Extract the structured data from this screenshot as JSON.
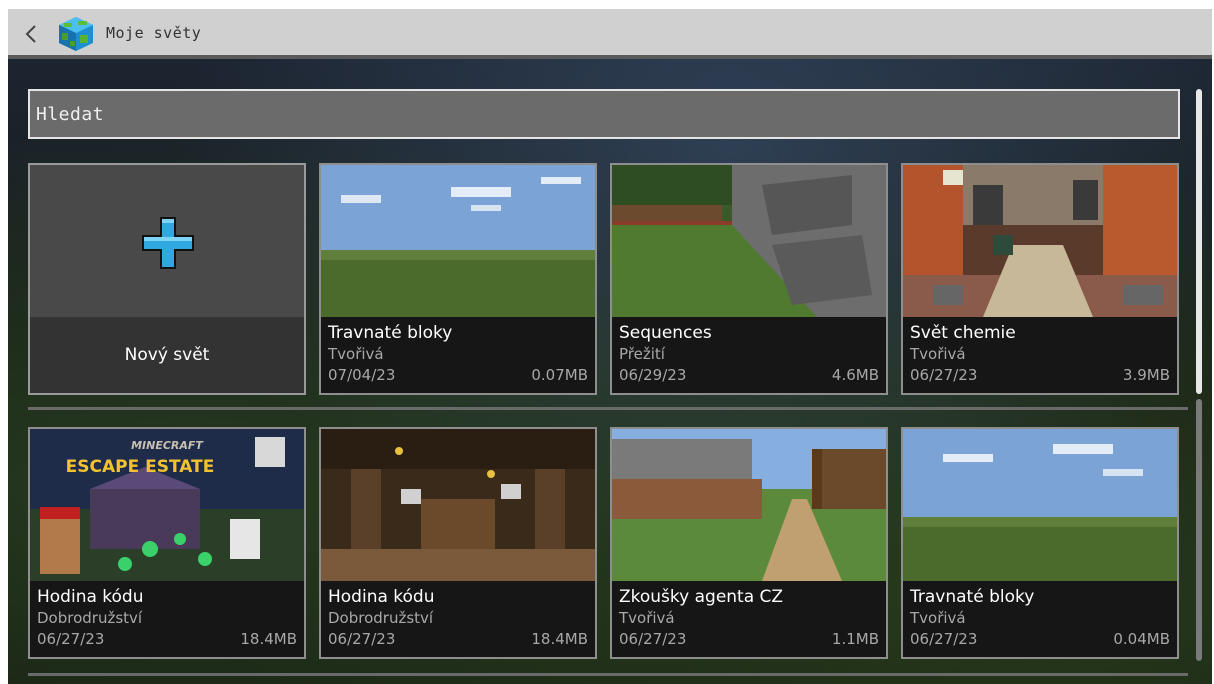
{
  "header": {
    "title": "Moje světy"
  },
  "search": {
    "label": "Hledat"
  },
  "new_world": {
    "label": "Nový svět"
  },
  "worlds": [
    {
      "name": "Travnaté bloky",
      "mode": "Tvořivá",
      "date": "07/04/23",
      "size": "0.07MB"
    },
    {
      "name": "Sequences",
      "mode": "Přežití",
      "date": "06/29/23",
      "size": "4.6MB"
    },
    {
      "name": "Svět chemie",
      "mode": "Tvořivá",
      "date": "06/27/23",
      "size": "3.9MB"
    },
    {
      "name": "Hodina kódu",
      "mode": "Dobrodružství",
      "date": "06/27/23",
      "size": "18.4MB"
    },
    {
      "name": "Hodina kódu",
      "mode": "Dobrodružství",
      "date": "06/27/23",
      "size": "18.4MB"
    },
    {
      "name": "Zkoušky agenta CZ",
      "mode": "Tvořivá",
      "date": "06/27/23",
      "size": "1.1MB"
    },
    {
      "name": "Travnaté bloky",
      "mode": "Tvořivá",
      "date": "06/27/23",
      "size": "0.04MB"
    }
  ],
  "thumbs": {
    "escape_line1": "MINECRAFT",
    "escape_line2": "ESCAPE ESTATE"
  },
  "colors": {
    "accent_plus": "#2fa8e0",
    "header_bg": "#d0d0d0"
  }
}
